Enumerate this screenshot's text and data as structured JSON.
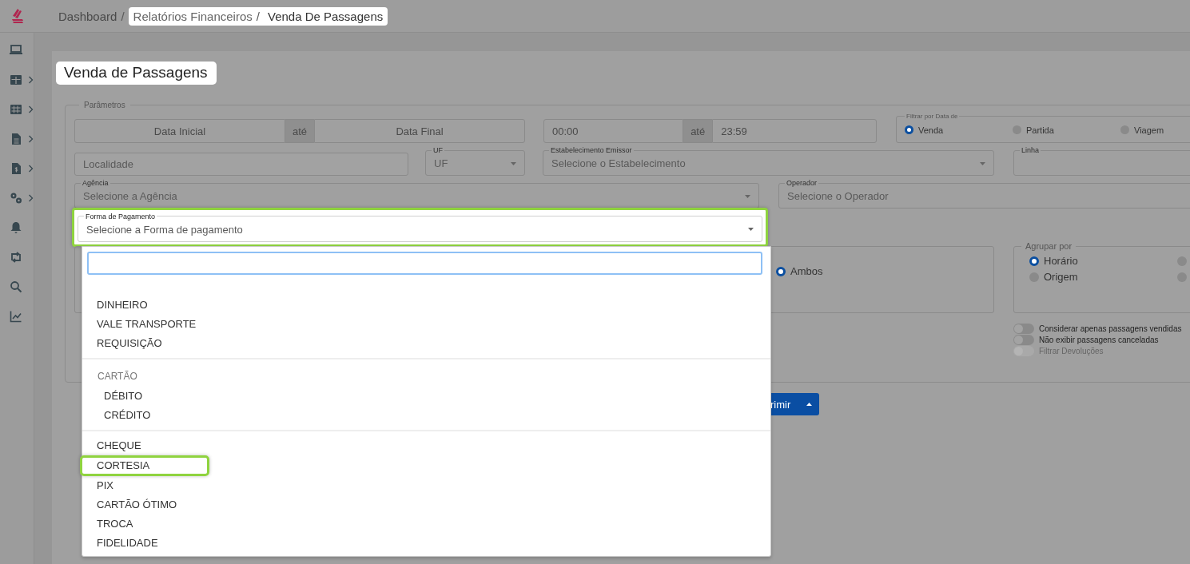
{
  "breadcrumb": [
    {
      "label": "Dashboard",
      "separator": "/",
      "highlighted": false
    },
    {
      "label": "Relatórios Financeiros",
      "separator": "/",
      "highlighted": true
    },
    {
      "label": "Venda De Passagens",
      "highlighted": true
    }
  ],
  "sidebar": {
    "items": [
      {
        "submenu": false
      },
      {
        "submenu": true
      },
      {
        "submenu": true
      },
      {
        "submenu": true
      },
      {
        "submenu": true
      },
      {
        "submenu": true
      },
      {
        "submenu": false
      },
      {
        "submenu": false
      },
      {
        "submenu": false
      },
      {
        "submenu": false
      }
    ]
  },
  "page_title": {
    "text": "Venda de Passagens",
    "highlighted": true
  },
  "parameters": {
    "legend": "Parâmetros",
    "date_range": {
      "start_placeholder": "Data Inicial",
      "separator": "até",
      "end_placeholder": "Data Final"
    },
    "time_range": {
      "start": "00:00",
      "separator": "até",
      "end": "23:59"
    },
    "date_filter": {
      "label": "Filtrar por Data de",
      "options": [
        {
          "label": "Venda",
          "selected": true
        },
        {
          "label": "Partida",
          "selected": false
        },
        {
          "label": "Viagem",
          "selected": false
        }
      ]
    },
    "locality": {
      "placeholder": "Localidade"
    },
    "uf": {
      "label": "UF",
      "value": "UF"
    },
    "issuer": {
      "label": "Estabelecimento Emissor",
      "placeholder": "Selecione o Estabelecimento"
    },
    "line": {
      "label": "Linha"
    },
    "agency": {
      "label": "Agência",
      "placeholder": "Selecione a Agência"
    },
    "operator": {
      "label": "Operador",
      "placeholder": "Selecione o Operador"
    },
    "payment": {
      "label": "Forma de Pagamento",
      "placeholder": "Selecione a Forma de pagamento",
      "highlighted": true
    },
    "type_options": [
      {
        "label": "Ambos",
        "selected": true
      }
    ],
    "group_by": {
      "label": "Agrupar por",
      "options": [
        {
          "label": "Horário",
          "selected": true
        },
        {
          "selected": false
        },
        {
          "label": "Origem",
          "selected": false
        },
        {
          "selected": false
        }
      ]
    },
    "toggles": [
      {
        "label": "Considerar apenas passagens vendidas",
        "on": false,
        "disabled": false
      },
      {
        "label": "Não exibir passagens canceladas",
        "on": false,
        "disabled": false
      },
      {
        "label": "Filtrar Devoluções",
        "on": false,
        "disabled": true
      }
    ]
  },
  "action_button": {
    "label": "rimir"
  },
  "payment_dropdown": {
    "groups": [
      {
        "options": [
          {
            "label": "DINHEIRO",
            "highlighted": false
          },
          {
            "label": "VALE TRANSPORTE",
            "highlighted": false
          },
          {
            "label": "REQUISIÇÃO",
            "highlighted": false
          }
        ]
      },
      {
        "label": "CARTÃO",
        "options": [
          {
            "label": "DÉBITO",
            "highlighted": false
          },
          {
            "label": "CRÉDITO",
            "highlighted": false
          }
        ]
      },
      {
        "options": [
          {
            "label": "CHEQUE",
            "highlighted": false
          },
          {
            "label": "CORTESIA",
            "highlighted": true
          },
          {
            "label": "PIX",
            "highlighted": false
          },
          {
            "label": "CARTÃO ÓTIMO",
            "highlighted": false
          },
          {
            "label": "TROCA",
            "highlighted": false
          },
          {
            "label": "FIDELIDADE",
            "highlighted": false
          }
        ]
      }
    ]
  }
}
